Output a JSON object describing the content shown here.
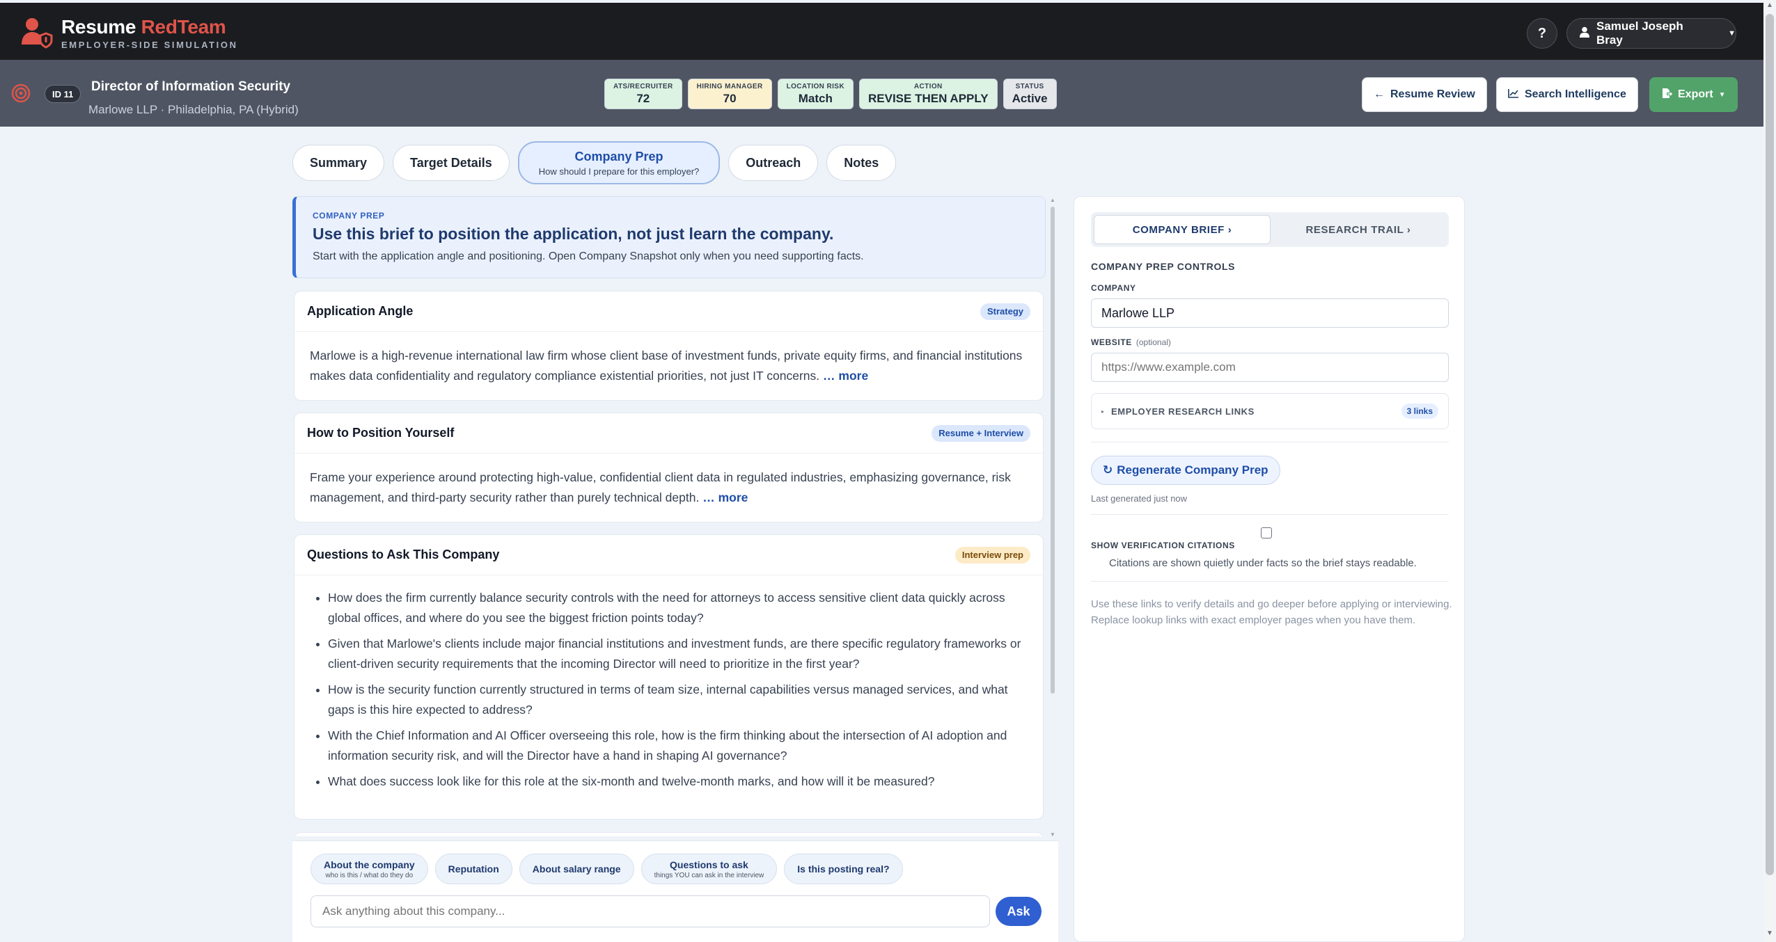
{
  "app": {
    "name_part1": "Resume",
    "name_part2": "RedTeam",
    "subtitle": "EMPLOYER-SIDE SIMULATION",
    "help_label": "?",
    "user_name": "Samuel Joseph Bray"
  },
  "job": {
    "id_label": "ID 11",
    "title": "Director of Information Security",
    "subtitle": "Marlowe LLP · Philadelphia, PA (Hybrid)",
    "metrics": [
      {
        "label": "ATS/RECRUITER",
        "value": "72",
        "color": "#dcf3e3"
      },
      {
        "label": "HIRING MANAGER",
        "value": "70",
        "color": "#fbf1cf"
      },
      {
        "label": "LOCATION RISK",
        "value": "Match",
        "color": "#dcf3e3"
      },
      {
        "label": "ACTION",
        "value": "REVISE THEN APPLY",
        "color": "#dcf3e3"
      },
      {
        "label": "STATUS",
        "value": "Active",
        "color": "#e5e7eb"
      }
    ],
    "buttons": {
      "resume_review": "Resume Review",
      "search_intel": "Search Intelligence",
      "export": "Export"
    }
  },
  "tabs": [
    {
      "label": "Summary"
    },
    {
      "label": "Target Details"
    },
    {
      "label": "Company Prep",
      "sub": "How should I prepare for this employer?"
    },
    {
      "label": "Outreach"
    },
    {
      "label": "Notes"
    }
  ],
  "brief": {
    "eyebrow": "COMPANY PREP",
    "headline": "Use this brief to position the application, not just learn the company.",
    "desc": "Start with the application angle and positioning. Open Company Snapshot only when you need supporting facts."
  },
  "cards": {
    "angle": {
      "title": "Application Angle",
      "tag": "Strategy",
      "body": "Marlowe is a high-revenue international law firm whose client base of investment funds, private equity firms, and financial institutions makes data confidentiality and regulatory compliance existential priorities, not just IT concerns.",
      "more": "… more"
    },
    "position": {
      "title": "How to Position Yourself",
      "tag": "Resume + Interview",
      "body": "Frame your experience around protecting high-value, confidential client data in regulated industries, emphasizing governance, risk management, and third-party security rather than purely technical depth.",
      "more": "… more"
    },
    "questions": {
      "title": "Questions to Ask This Company",
      "tag": "Interview prep",
      "items": [
        "How does the firm currently balance security controls with the need for attorneys to access sensitive client data quickly across global offices, and where do you see the biggest friction points today?",
        "Given that Marlowe's clients include major financial institutions and investment funds, are there specific regulatory frameworks or client-driven security requirements that the incoming Director will need to prioritize in the first year?",
        "How is the security function currently structured in terms of team size, internal capabilities versus managed services, and what gaps is this hire expected to address?",
        "With the Chief Information and AI Officer overseeing this role, how is the firm thinking about the intersection of AI adoption and information security risk, and will the Director have a hand in shaping AI governance?",
        "What does success look like for this role at the six-month and twelve-month marks, and how will it be measured?"
      ]
    }
  },
  "ask": {
    "chips": [
      {
        "label": "About the company",
        "sub": "who is this / what do they do"
      },
      {
        "label": "Reputation",
        "sub": ""
      },
      {
        "label": "About salary range",
        "sub": ""
      },
      {
        "label": "Questions to ask",
        "sub": "things YOU can ask in the interview"
      },
      {
        "label": "Is this posting real?",
        "sub": ""
      }
    ],
    "placeholder": "Ask anything about this company...",
    "button": "Ask"
  },
  "right": {
    "seg_brief": "COMPANY BRIEF ›",
    "seg_trail": "RESEARCH TRAIL ›",
    "heading": "COMPANY PREP CONTROLS",
    "company_label": "COMPANY",
    "company_value": "Marlowe LLP",
    "website_label": "WEBSITE",
    "website_optional": "(optional)",
    "website_placeholder": "https://www.example.com",
    "links_title": "EMPLOYER RESEARCH LINKS",
    "links_count": "3 links",
    "regen_label": "Regenerate Company Prep",
    "last_generated": "Last generated just now",
    "citations_label": "SHOW VERIFICATION CITATIONS",
    "citations_desc": "Citations are shown quietly under facts so the brief stays readable.",
    "note": "Use these links to verify details and go deeper before applying or interviewing. Replace lookup links with exact employer pages when you have them."
  },
  "colors": {
    "brand_red": "#e0544a",
    "accent_blue": "#2f5fd0",
    "export_green": "#52a36a"
  }
}
